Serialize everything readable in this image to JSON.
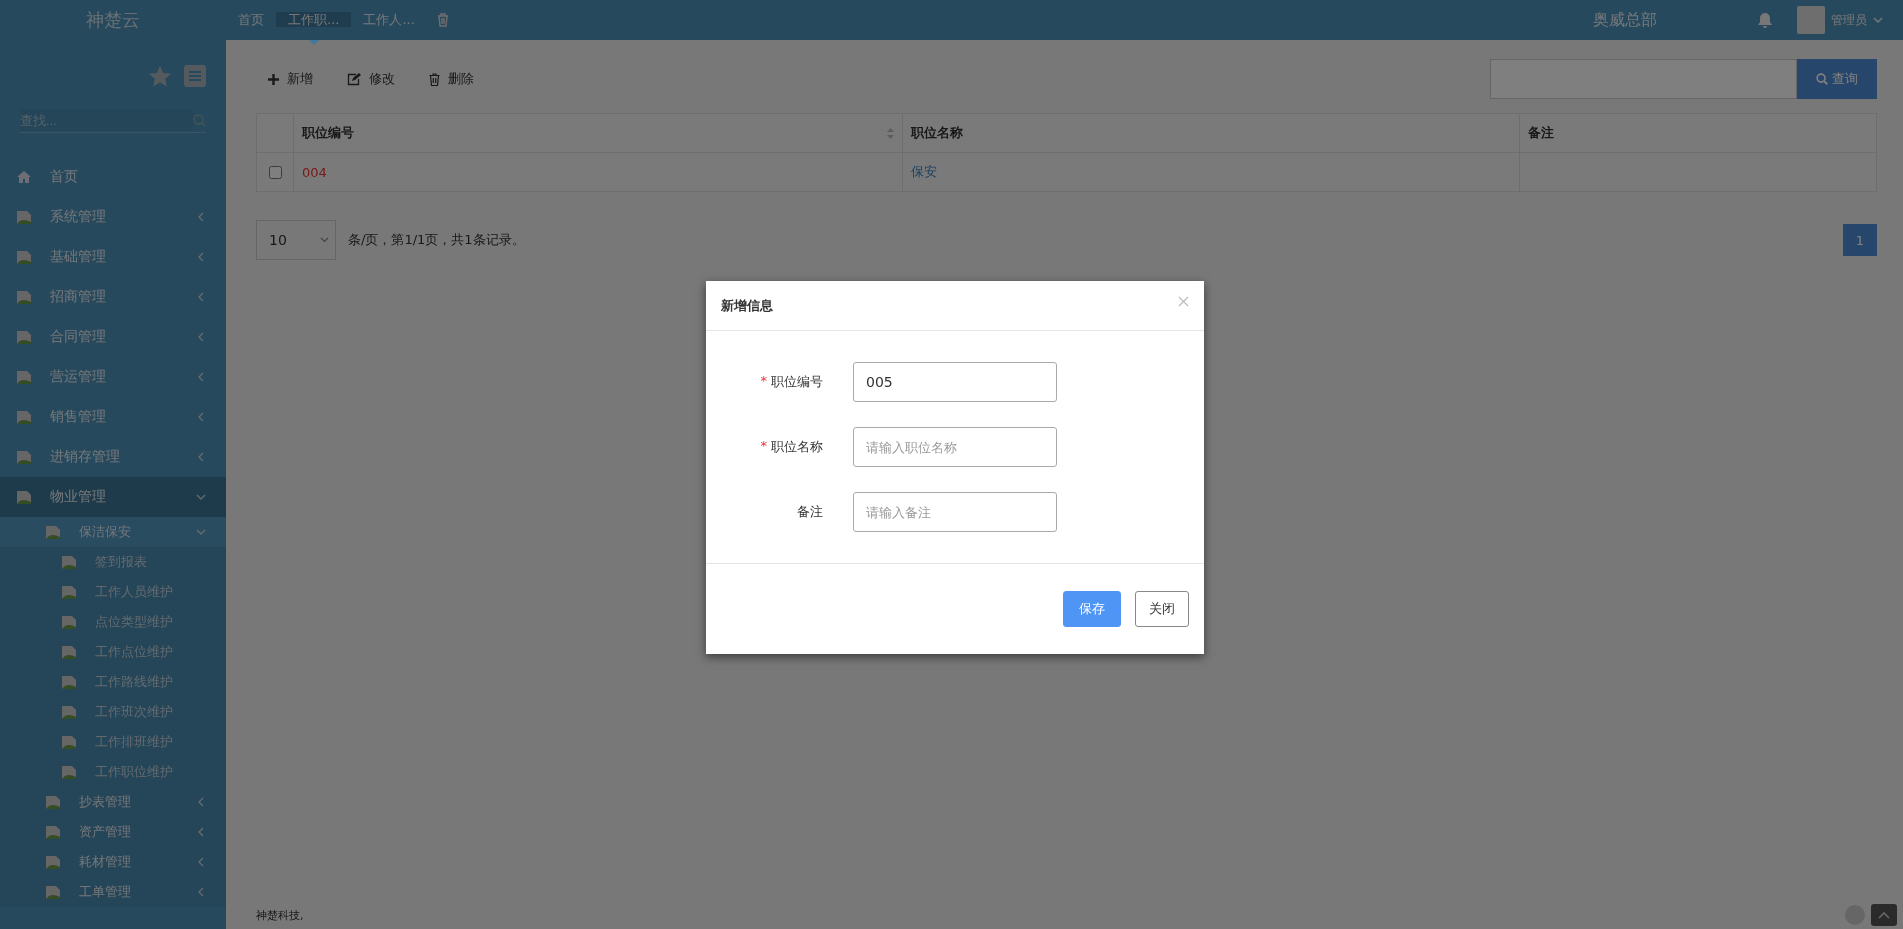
{
  "brand": "神楚云",
  "tabs": [
    {
      "label": "首页",
      "selected": false
    },
    {
      "label": "工作职...",
      "selected": true
    },
    {
      "label": "工作人...",
      "selected": false
    }
  ],
  "header": {
    "org": "奥威总部",
    "user": "管理员"
  },
  "sidebar": {
    "search": {
      "placeholder": "查找..."
    },
    "items": [
      {
        "label": "首页",
        "kind": "home"
      },
      {
        "label": "系统管理",
        "kind": "group",
        "expanded": false
      },
      {
        "label": "基础管理",
        "kind": "group",
        "expanded": false
      },
      {
        "label": "招商管理",
        "kind": "group",
        "expanded": false
      },
      {
        "label": "合同管理",
        "kind": "group",
        "expanded": false
      },
      {
        "label": "营运管理",
        "kind": "group",
        "expanded": false
      },
      {
        "label": "销售管理",
        "kind": "group",
        "expanded": false
      },
      {
        "label": "进销存管理",
        "kind": "group",
        "expanded": false
      },
      {
        "label": "物业管理",
        "kind": "group",
        "expanded": true,
        "children": [
          {
            "label": "保洁保安",
            "kind": "group",
            "expanded": true,
            "children": [
              {
                "label": "签到报表",
                "kind": "leaf"
              },
              {
                "label": "工作人员维护",
                "kind": "leaf"
              },
              {
                "label": "点位类型维护",
                "kind": "leaf"
              },
              {
                "label": "工作点位维护",
                "kind": "leaf"
              },
              {
                "label": "工作路线维护",
                "kind": "leaf"
              },
              {
                "label": "工作班次维护",
                "kind": "leaf"
              },
              {
                "label": "工作排班维护",
                "kind": "leaf"
              },
              {
                "label": "工作职位维护",
                "kind": "leaf"
              }
            ]
          },
          {
            "label": "抄表管理",
            "kind": "group",
            "expanded": false
          },
          {
            "label": "资产管理",
            "kind": "group",
            "expanded": false
          },
          {
            "label": "耗材管理",
            "kind": "group",
            "expanded": false
          },
          {
            "label": "工单管理",
            "kind": "group",
            "expanded": false
          }
        ]
      }
    ]
  },
  "toolbar": [
    {
      "label": "新增",
      "kind": "add"
    },
    {
      "label": "修改",
      "kind": "edit"
    },
    {
      "label": "删除",
      "kind": "delete"
    }
  ],
  "query_button": "查询",
  "table": {
    "columns": [
      {
        "label": "职位编号",
        "sortable": true
      },
      {
        "label": "职位名称",
        "sortable": false
      },
      {
        "label": "备注",
        "sortable": false
      }
    ],
    "rows": [
      {
        "checked": false,
        "cells": [
          "004",
          "保安",
          ""
        ]
      }
    ]
  },
  "pagination": {
    "page_size": "10",
    "summary": "条/页，第1/1页，共1条记录。",
    "pages": [
      {
        "label": "1",
        "selected": true
      }
    ]
  },
  "footer": "神楚科技,",
  "dialog": {
    "title": "新增信息",
    "required_mark": "*",
    "fields": [
      {
        "label": "职位编号",
        "required": true,
        "value": "005"
      },
      {
        "label": "职位名称",
        "required": true,
        "placeholder": "请输入职位名称"
      },
      {
        "label": "备注",
        "required": false,
        "placeholder": "请输入备注"
      }
    ],
    "buttons": [
      {
        "label": "保存",
        "kind": "primary"
      },
      {
        "label": "关闭",
        "kind": "default"
      }
    ]
  }
}
